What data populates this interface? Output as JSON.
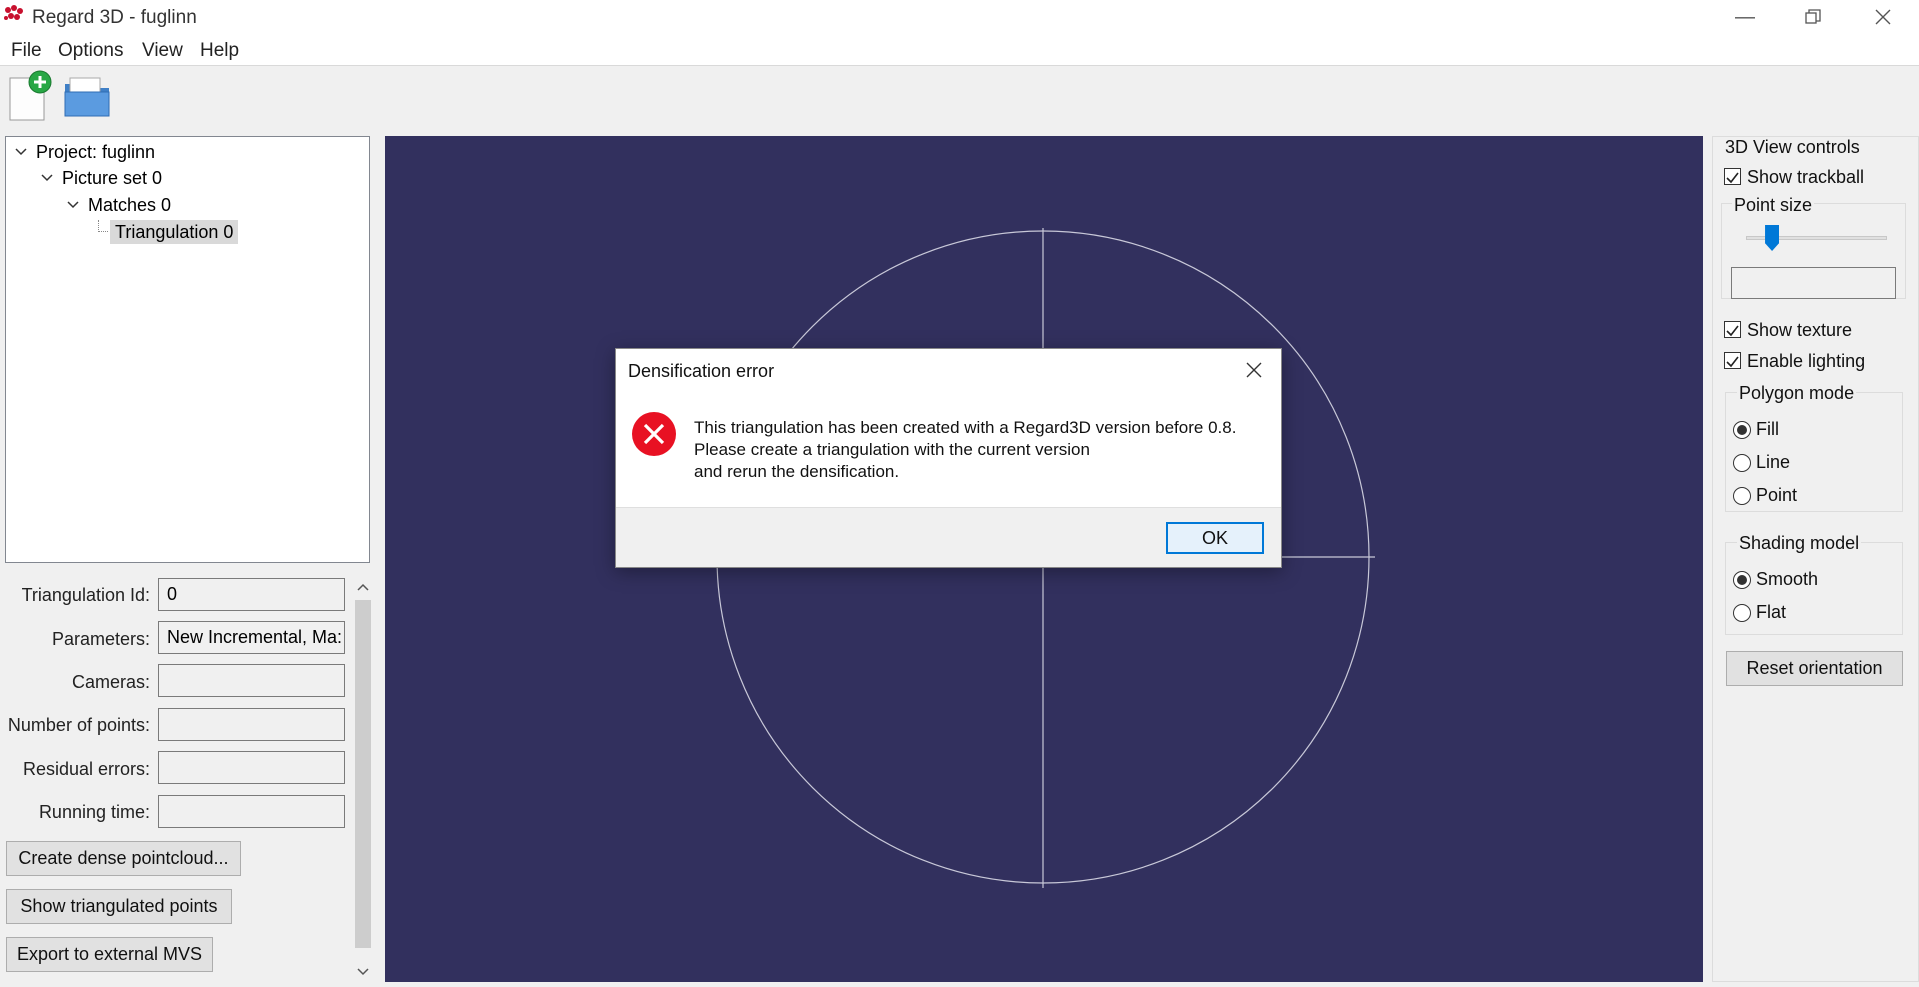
{
  "window": {
    "title": "Regard 3D - fuglinn"
  },
  "menu": {
    "file": "File",
    "options": "Options",
    "view": "View",
    "help": "Help"
  },
  "tree": {
    "project": "Project: fuglinn",
    "picture_set": "Picture set 0",
    "matches": "Matches 0",
    "triangulation": "Triangulation 0"
  },
  "properties": {
    "triangulation_id": {
      "label": "Triangulation Id:",
      "value": "0"
    },
    "parameters": {
      "label": "Parameters:",
      "value": "New Incremental, Ma:"
    },
    "cameras": {
      "label": "Cameras:",
      "value": ""
    },
    "number_of_points": {
      "label": "Number of points:",
      "value": ""
    },
    "residual_errors": {
      "label": "Residual errors:",
      "value": ""
    },
    "running_time": {
      "label": "Running time:",
      "value": ""
    }
  },
  "buttons": {
    "create_dense": "Create dense pointcloud...",
    "show_triangulated": "Show triangulated points",
    "export_mvs": "Export to external MVS"
  },
  "view_controls": {
    "title": "3D View controls",
    "show_trackball": "Show trackball",
    "point_size": "Point size",
    "point_size_slider": 0.15,
    "point_size_value": "",
    "show_texture": "Show texture",
    "enable_lighting": "Enable lighting",
    "polygon_mode": "Polygon mode",
    "fill": "Fill",
    "line": "Line",
    "point": "Point",
    "shading_model": "Shading model",
    "smooth": "Smooth",
    "flat": "Flat",
    "reset_orientation": "Reset orientation"
  },
  "dialog": {
    "title": "Densification error",
    "line1": "This triangulation has been created with a Regard3D version before 0.8.",
    "line2": "Please create a triangulation with the current version",
    "line3": "and rerun the densification.",
    "ok": "OK"
  },
  "colors": {
    "viewport": "#32305e",
    "trackball": "#c8c8d8",
    "error": "#e81123",
    "accent": "#0078d7"
  }
}
